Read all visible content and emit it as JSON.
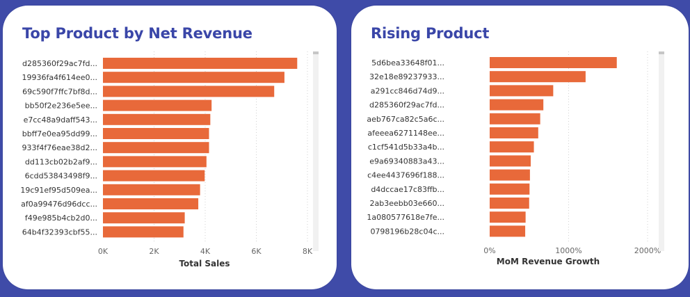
{
  "colors": {
    "bar": "#e8693a",
    "title": "#3a46a8",
    "grid": "#d0d0d0",
    "axis_text": "#666666",
    "label_text": "#333333"
  },
  "chart_data": [
    {
      "type": "bar",
      "orientation": "horizontal",
      "title": "Top Product by Net Revenue",
      "xlabel": "Total Sales",
      "ylabel": "",
      "xlim": [
        0,
        8000
      ],
      "ticks": [
        0,
        2000,
        4000,
        6000,
        8000
      ],
      "tick_labels": [
        "0K",
        "2K",
        "4K",
        "6K",
        "8K"
      ],
      "categories": [
        "d285360f29ac7fd...",
        "19936fa4f614ee0...",
        "69c590f7ffc7bf8d...",
        "bb50f2e236e5ee...",
        "e7cc48a9daff543...",
        "bbff7e0ea95dd99...",
        "933f4f76eae38d2...",
        "dd113cb02b2af9...",
        "6cdd53843498f9...",
        "19c91ef95d509ea...",
        "af0a99476d96dcc...",
        "f49e985b4cb2d0...",
        "64b4f32393cbf55..."
      ],
      "values": [
        7600,
        7100,
        6700,
        4250,
        4200,
        4150,
        4150,
        4050,
        3980,
        3800,
        3730,
        3200,
        3150
      ],
      "grid": true
    },
    {
      "type": "bar",
      "orientation": "horizontal",
      "title": "Rising Product",
      "xlabel": "MoM Revenue Growth",
      "ylabel": "",
      "xlim": [
        0,
        2000
      ],
      "ticks": [
        0,
        1000,
        2000
      ],
      "tick_labels": [
        "0%",
        "1000%",
        "2000%"
      ],
      "categories": [
        "5d6bea33648f01...",
        "32e18e89237933...",
        "a291cc846d74d9...",
        "d285360f29ac7fd...",
        "aeb767ca82c5a6c...",
        "afeeea6271148ee...",
        "c1cf541d5b33a4b...",
        "e9a69340883a43...",
        "c4ee4437696f188...",
        "d4dccae17c83ffb...",
        "2ab3eebb03e660...",
        "1a080577618e7fe...",
        "0798196b28c04c..."
      ],
      "values": [
        1610,
        1215,
        805,
        680,
        640,
        615,
        560,
        520,
        510,
        505,
        500,
        455,
        450
      ],
      "grid": true
    }
  ]
}
